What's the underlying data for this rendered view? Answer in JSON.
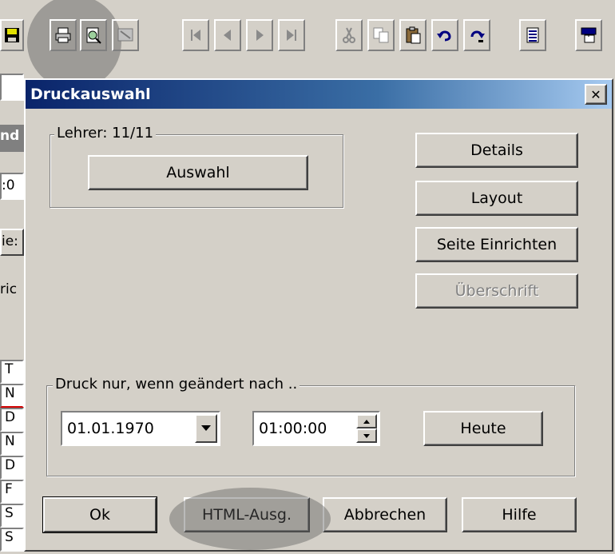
{
  "toolbar": {
    "buttons": [
      {
        "name": "save-icon",
        "glyph": "💾"
      },
      {
        "name": "print-icon",
        "glyph": "🖨"
      },
      {
        "name": "print-preview-icon",
        "glyph": "🔍"
      },
      {
        "name": "screen-export-icon",
        "glyph": "▣"
      },
      {
        "name": "first-record-icon",
        "glyph": "|◄"
      },
      {
        "name": "previous-record-icon",
        "glyph": "◄"
      },
      {
        "name": "next-record-icon",
        "glyph": "►"
      },
      {
        "name": "last-record-icon",
        "glyph": "►|"
      },
      {
        "name": "cut-icon",
        "glyph": "✂"
      },
      {
        "name": "copy-icon",
        "glyph": "⧉"
      },
      {
        "name": "paste-icon",
        "glyph": "📋"
      },
      {
        "name": "undo-icon",
        "glyph": "↶"
      },
      {
        "name": "redo-icon",
        "glyph": "↷"
      },
      {
        "name": "list-icon",
        "glyph": "☰"
      },
      {
        "name": "window-icon",
        "glyph": "⊞"
      }
    ]
  },
  "background": {
    "fragments": [
      "nd",
      ":0",
      "ie:",
      "ric",
      "T",
      "N",
      "D",
      "N",
      "D",
      "F",
      "S",
      "S"
    ]
  },
  "dialog": {
    "title": "Druckauswahl",
    "close_glyph": "✕",
    "teacher_group": {
      "label": "Lehrer: 11/11",
      "select_button": "Auswahl"
    },
    "right_buttons": {
      "details": "Details",
      "layout": "Layout",
      "page_setup": "Seite Einrichten",
      "heading": "Überschrift"
    },
    "date_group": {
      "label": "Druck nur, wenn geändert nach ..",
      "date_value": "01.01.1970",
      "time_value": "01:00:00",
      "today_button": "Heute"
    },
    "bottom_buttons": {
      "ok": "Ok",
      "html": "HTML-Ausg.",
      "cancel": "Abbrechen",
      "help": "Hilfe"
    }
  },
  "colors": {
    "face": "#d4d0c8",
    "title_start": "#0a246a",
    "title_end": "#a6caf0",
    "disabled_text": "#808080"
  }
}
